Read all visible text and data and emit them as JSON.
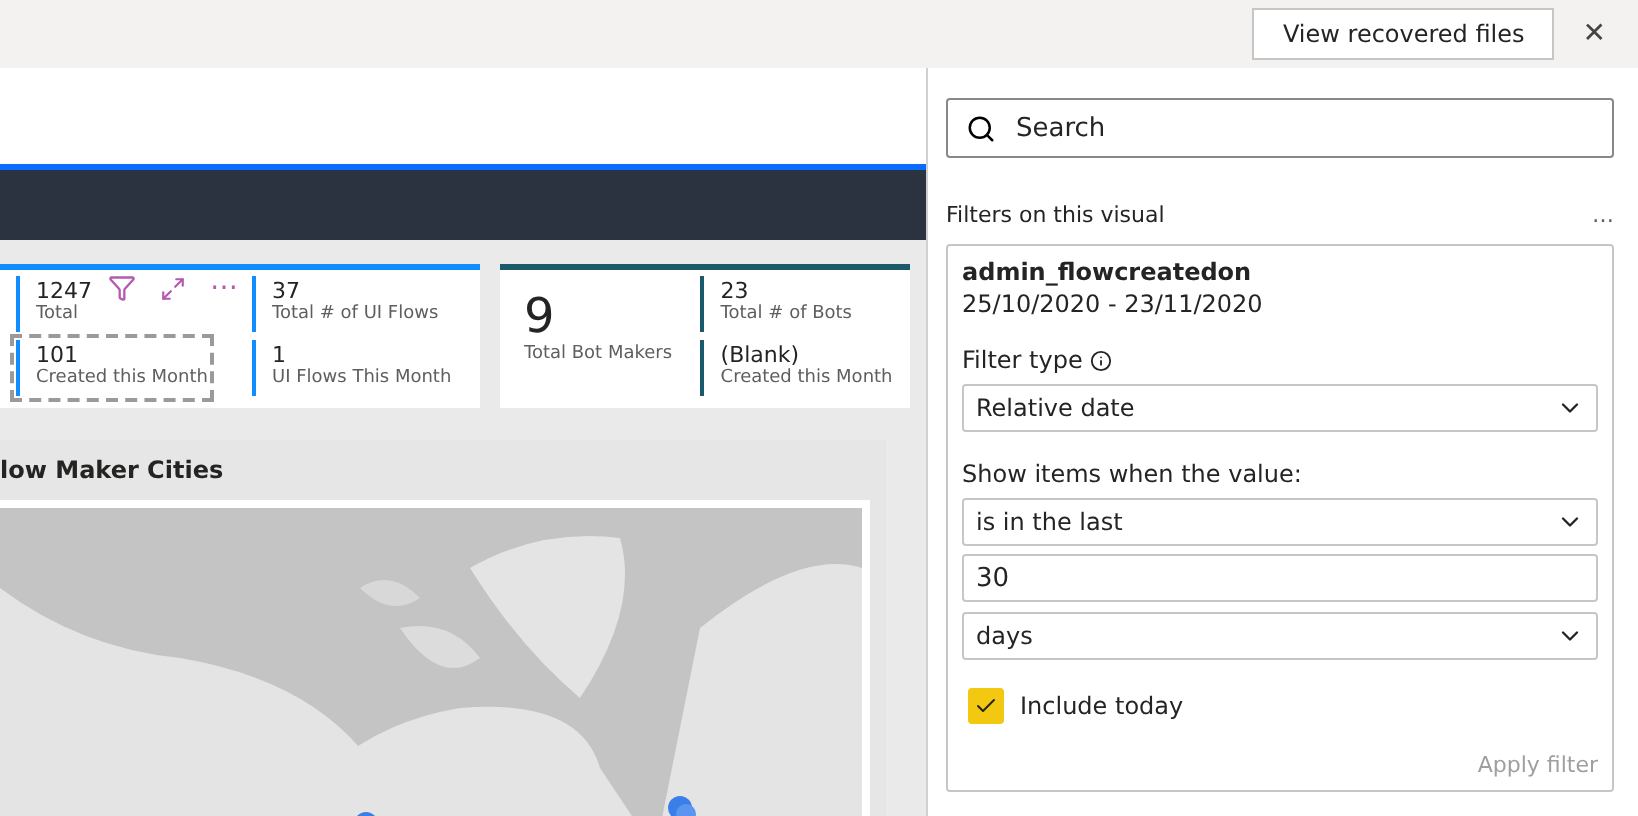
{
  "top_bar": {
    "recover_button": "View recovered files",
    "close": "✕"
  },
  "cards": [
    {
      "color": "#118dff",
      "items": [
        {
          "value": "1247",
          "label": "Total"
        },
        {
          "value": "101",
          "label": "Created this Month",
          "selected": true
        },
        {
          "value": "37",
          "label": "Total # of UI Flows"
        },
        {
          "value": "1",
          "label": "UI Flows This Month"
        }
      ]
    },
    {
      "color": "#1b5a6b",
      "big": {
        "value": "9",
        "label": "Total Bot Makers"
      },
      "items": [
        {
          "value": "23",
          "label": "Total # of Bots"
        },
        {
          "value": "(Blank)",
          "label": "Created this Month"
        }
      ]
    }
  ],
  "visual_header": {
    "more": "⋯"
  },
  "map_panel": {
    "title": "low Maker Cities"
  },
  "filter_pane": {
    "search": {
      "placeholder": "Search"
    },
    "section_title": "Filters on this visual",
    "more": "…",
    "filter": {
      "field": "admin_flowcreatedon",
      "range": "25/10/2020 - 23/11/2020",
      "type_label": "Filter type",
      "type_value": "Relative date",
      "condition_label": "Show items when the value:",
      "operator": "is in the last",
      "amount": "30",
      "unit": "days",
      "include_today": {
        "label": "Include today",
        "checked": true
      },
      "apply": {
        "label": "Apply filter",
        "disabled": true
      }
    }
  }
}
